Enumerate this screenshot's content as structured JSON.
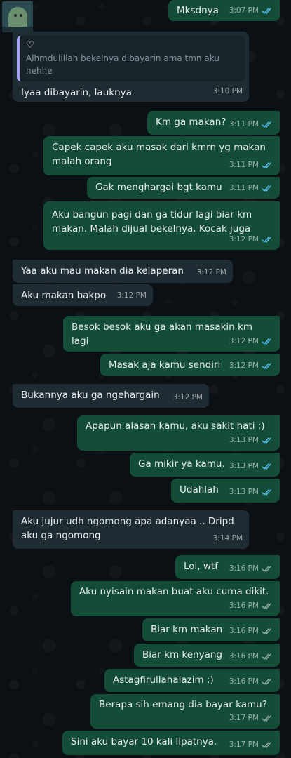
{
  "contact": {
    "avatar": "contact-avatar"
  },
  "colors": {
    "outgoing": "#144d37",
    "incoming": "#1f2c33",
    "read_tick": "#53bdeb"
  },
  "messages": [
    {
      "text": "Mksdnya",
      "time": "3:07 PM",
      "dir": "out",
      "status": "read"
    },
    {
      "reply_symbol": "♡",
      "reply_text": "Alhmdulillah bekelnya dibayarin ama tmn aku\nhehhe",
      "text": "Iyaa dibayarin, lauknya",
      "time": "3:10 PM",
      "dir": "in"
    },
    {
      "text": "Km ga makan?",
      "time": "3:11 PM",
      "dir": "out",
      "status": "read"
    },
    {
      "text": "Capek capek aku masak dari kmrn yg makan\nmalah orang",
      "time": "3:11 PM",
      "dir": "out",
      "status": "read"
    },
    {
      "text": "Gak menghargai bgt kamu",
      "time": "3:11 PM",
      "dir": "out",
      "status": "read"
    },
    {
      "text": "Aku bangun pagi dan ga tidur lagi biar km\nmakan. Malah dijual bekelnya. Kocak juga",
      "time": "3:12 PM",
      "dir": "out",
      "status": "read"
    },
    {
      "text": "Yaa aku mau makan dia kelaperan",
      "time": "3:12 PM",
      "dir": "in"
    },
    {
      "text": "Aku makan bakpo",
      "time": "3:12 PM",
      "dir": "in"
    },
    {
      "text": "Besok besok aku ga akan masakin km lagi",
      "time": "3:12 PM",
      "dir": "out",
      "status": "read"
    },
    {
      "text": "Masak aja kamu sendiri",
      "time": "3:12 PM",
      "dir": "out",
      "status": "read"
    },
    {
      "text": "Bukannya aku ga ngehargain",
      "time": "3:12 PM",
      "dir": "in"
    },
    {
      "text": "Apapun alasan kamu, aku sakit hati :)",
      "time": "3:13 PM",
      "dir": "out",
      "status": "read"
    },
    {
      "text": "Ga mikir ya kamu.",
      "time": "3:13 PM",
      "dir": "out",
      "status": "read"
    },
    {
      "text": "Udahlah",
      "time": "3:13 PM",
      "dir": "out",
      "status": "read"
    },
    {
      "text": "Aku jujur udh ngomong apa adanyaa .. Dripd\naku ga ngomong",
      "time": "3:14 PM",
      "dir": "in"
    },
    {
      "text": "Lol, wtf",
      "time": "3:16 PM",
      "dir": "out",
      "status": "delivered"
    },
    {
      "text": "Aku nyisain makan buat aku cuma dikit.",
      "time": "3:16 PM",
      "dir": "out",
      "status": "delivered"
    },
    {
      "text": "Biar km makan",
      "time": "3:16 PM",
      "dir": "out",
      "status": "delivered"
    },
    {
      "text": "Biar km kenyang",
      "time": "3:16 PM",
      "dir": "out",
      "status": "delivered"
    },
    {
      "text": "Astagfirullahalazim :)",
      "time": "3:16 PM",
      "dir": "out",
      "status": "delivered"
    },
    {
      "text": "Berapa sih emang dia bayar kamu?",
      "time": "3:17 PM",
      "dir": "out",
      "status": "delivered"
    },
    {
      "text": "Sini aku bayar 10 kali lipatnya.",
      "time": "3:17 PM",
      "dir": "out",
      "status": "delivered"
    }
  ]
}
